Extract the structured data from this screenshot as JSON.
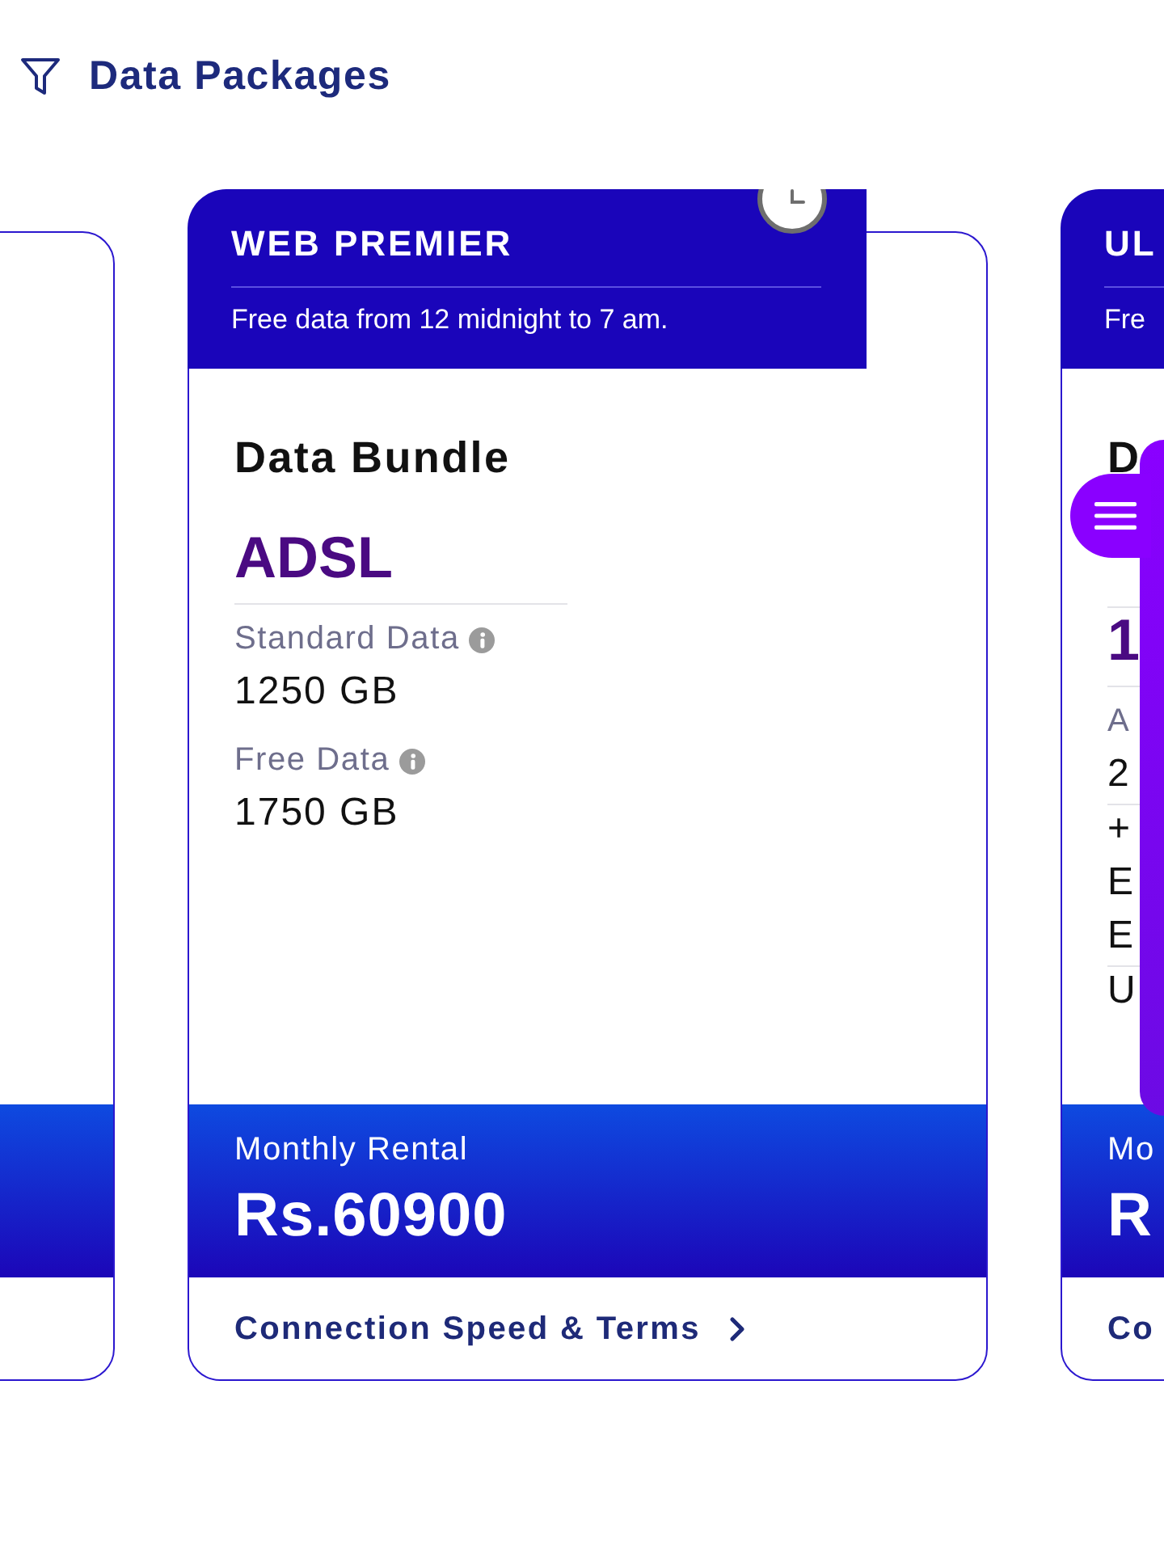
{
  "header": {
    "title": "Data Packages"
  },
  "cards": [
    {
      "kind": "package"
    },
    {
      "kind": "package",
      "title": "WEB PREMIER",
      "subtitle": "Free data from 12 midnight to 7 am.",
      "clock_badge": true,
      "body": [
        {
          "kind": "heading",
          "text": "Data Bundle"
        },
        {
          "kind": "plan",
          "text": "ADSL",
          "rule_above": false
        },
        {
          "kind": "label",
          "text": "Standard Data",
          "info": true
        },
        {
          "kind": "value",
          "text": "1250 GB",
          "rule_above": false
        },
        {
          "kind": "label",
          "text": "Free Data",
          "info": true
        },
        {
          "kind": "value",
          "text": "1750 GB",
          "rule_above": false
        }
      ],
      "rental_label": "Monthly Rental",
      "price": "Rs.60900",
      "link": "Connection Speed & Terms"
    },
    {
      "kind": "package",
      "title": "UL",
      "subtitle": "Fre",
      "body": [
        {
          "kind": "heading",
          "text": "D"
        },
        {
          "kind": "plan",
          "text": "1",
          "rule_above": true
        },
        {
          "kind": "label",
          "text": "A",
          "info": false
        },
        {
          "kind": "value",
          "text": "2",
          "rule_above": false
        },
        {
          "kind": "value",
          "text": "+",
          "rule_above": true
        },
        {
          "kind": "value",
          "text": "E",
          "rule_above": false
        },
        {
          "kind": "value",
          "text": "E",
          "rule_above": false
        },
        {
          "kind": "value",
          "text": "U",
          "rule_above": true
        }
      ],
      "rental_label": "Mo",
      "price": "R",
      "link": "Co"
    }
  ],
  "side_menu": {
    "expanded": false
  }
}
